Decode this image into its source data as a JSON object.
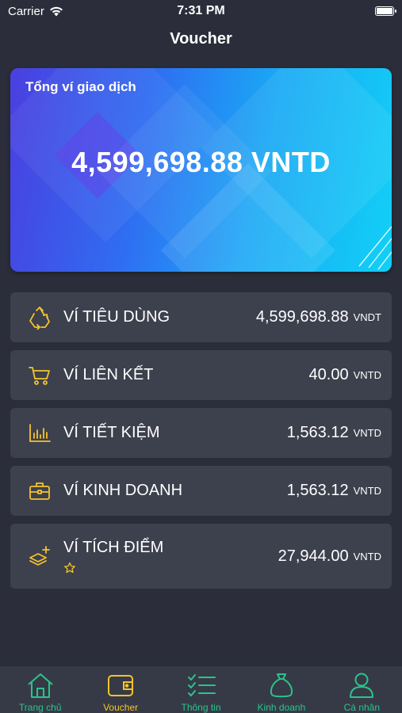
{
  "status_bar": {
    "carrier": "Carrier",
    "time": "7:31 PM"
  },
  "header": {
    "title": "Voucher"
  },
  "card": {
    "label": "Tổng ví giao dịch",
    "amount": "4,599,698.88 VNTD"
  },
  "wallets": [
    {
      "icon": "recycle-icon",
      "name": "VÍ TIÊU DÙNG",
      "value": "4,599,698.88",
      "unit": "VNDT"
    },
    {
      "icon": "cart-icon",
      "name": "VÍ LIÊN KẾT",
      "value": "40.00",
      "unit": "VNTD"
    },
    {
      "icon": "bar-chart-icon",
      "name": "VÍ TIẾT KIỆM",
      "value": "1,563.12",
      "unit": "VNTD"
    },
    {
      "icon": "briefcase-icon",
      "name": "VÍ KINH DOANH",
      "value": "1,563.12",
      "unit": "VNTD"
    },
    {
      "icon": "stack-add-icon",
      "name": "VÍ TÍCH ĐIỂM",
      "value": "27,944.00",
      "unit": "VNTD"
    }
  ],
  "tabs": [
    {
      "label": "Trang chủ",
      "icon": "home-icon",
      "active": false
    },
    {
      "label": "Voucher",
      "icon": "wallet-icon",
      "active": true
    },
    {
      "label": "Thông tin",
      "icon": "checklist-icon",
      "active": false
    },
    {
      "label": "Kinh doanh",
      "icon": "money-bag-icon",
      "active": false
    },
    {
      "label": "Cá nhân",
      "icon": "user-icon",
      "active": false
    }
  ],
  "colors": {
    "accent": "#f5c42a",
    "tab_inactive": "#2bc489",
    "background": "#2b2e3a",
    "row": "#3d404d"
  }
}
